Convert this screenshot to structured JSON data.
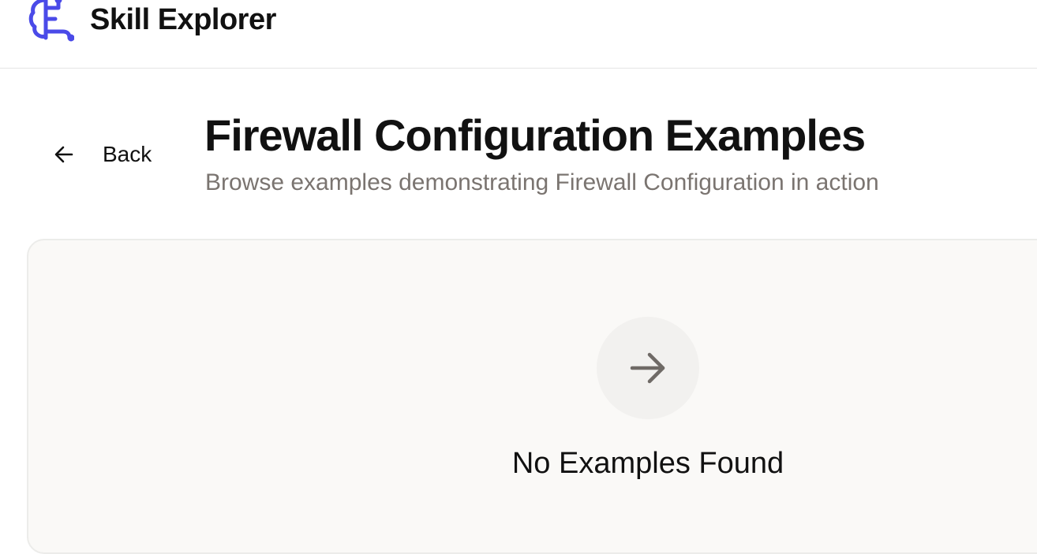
{
  "header": {
    "app_name": "Skill Explorer",
    "logo_icon": "brain-icon",
    "accent_color": "#4a4ae8"
  },
  "nav": {
    "back_label": "Back",
    "back_icon": "arrow-left-icon"
  },
  "page": {
    "title": "Firewall Configuration Examples",
    "subtitle": "Browse examples demonstrating Firewall Configuration in action"
  },
  "empty_state": {
    "icon": "arrow-right-icon",
    "title": "No Examples Found"
  }
}
